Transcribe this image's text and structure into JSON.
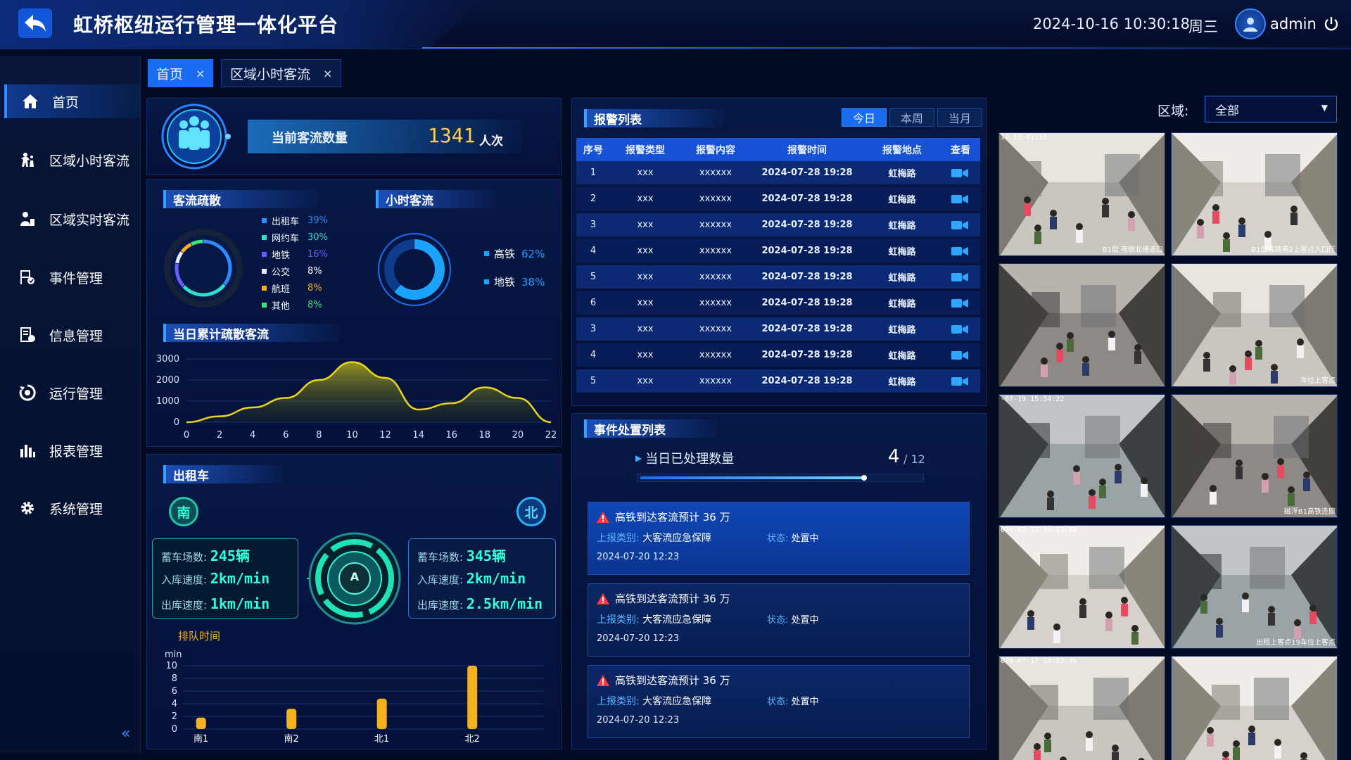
{
  "header": {
    "title": "虹桥枢纽运行管理一体化平台",
    "datetime": "2024-10-16 10:30:18",
    "weekday": "周三",
    "username": "admin"
  },
  "sidebar": {
    "items": [
      {
        "label": "首页",
        "icon": "home-icon"
      },
      {
        "label": "区域小时客流",
        "icon": "crowd-icon"
      },
      {
        "label": "区域实时客流",
        "icon": "person-icon"
      },
      {
        "label": "事件管理",
        "icon": "event-icon"
      },
      {
        "label": "信息管理",
        "icon": "info-icon"
      },
      {
        "label": "运行管理",
        "icon": "operation-icon"
      },
      {
        "label": "报表管理",
        "icon": "chart-icon"
      },
      {
        "label": "系统管理",
        "icon": "gear-icon"
      }
    ],
    "collapse": "«"
  },
  "tabs": [
    {
      "label": "首页",
      "close": "×"
    },
    {
      "label": "区域小时客流",
      "close": "×"
    }
  ],
  "current": {
    "label": "当前客流数量",
    "value": "1341",
    "unit": "人次"
  },
  "dispersal": {
    "title": "客流疏散",
    "items": [
      {
        "name": "出租车",
        "pct": "39%",
        "value": 39,
        "color": "#2f8bff"
      },
      {
        "name": "网约车",
        "pct": "30%",
        "value": 30,
        "color": "#2fe0c8"
      },
      {
        "name": "地铁",
        "pct": "16%",
        "value": 16,
        "color": "#6a5cff"
      },
      {
        "name": "公交",
        "pct": "8%",
        "value": 8,
        "color": "#e6ecff"
      },
      {
        "name": "航班",
        "pct": "8%",
        "value": 8,
        "color": "#f5b21f"
      },
      {
        "name": "其他",
        "pct": "8%",
        "value": 8,
        "color": "#3ee37a"
      }
    ]
  },
  "hourly": {
    "title": "小时客流",
    "items": [
      {
        "name": "高铁",
        "pct": "62%",
        "value": 62,
        "color": "#1aa3ff"
      },
      {
        "name": "地铁",
        "pct": "38%",
        "value": 38,
        "color": "#0e3c8c"
      }
    ]
  },
  "cumulative": {
    "title": "当日累计疏散客流"
  },
  "chart_data": [
    {
      "type": "area",
      "title": "当日累计疏散客流",
      "x": [
        0,
        2,
        4,
        6,
        8,
        10,
        12,
        14,
        16,
        18,
        20,
        22
      ],
      "series": [
        {
          "values": [
            0,
            280,
            700,
            1150,
            2000,
            2850,
            2100,
            600,
            900,
            1650,
            1150,
            0
          ]
        }
      ],
      "xticks": [
        "0",
        "2",
        "4",
        "6",
        "8",
        "10",
        "12",
        "14",
        "16",
        "18",
        "20",
        "22"
      ],
      "yticks": [
        "0",
        "1000",
        "2000",
        "3000"
      ],
      "ylim": [
        0,
        3000
      ],
      "xlim": [
        0,
        22
      ],
      "grid": true
    },
    {
      "type": "bar",
      "title": "排队时间",
      "ylabel": "min",
      "categories": [
        "南1",
        "南2",
        "北1",
        "北2"
      ],
      "values": [
        1.8,
        3.2,
        4.8,
        10
      ],
      "ylim": [
        0,
        10
      ],
      "yticks": [
        "0",
        "2",
        "4",
        "6",
        "8",
        "10"
      ],
      "grid": true
    },
    {
      "type": "pie",
      "title": "客流疏散",
      "categories": [
        "出租车",
        "网约车",
        "地铁",
        "公交",
        "航班",
        "其他"
      ],
      "values": [
        39,
        30,
        16,
        8,
        8,
        8
      ]
    },
    {
      "type": "pie",
      "title": "小时客流",
      "categories": [
        "高铁",
        "地铁"
      ],
      "values": [
        62,
        38
      ]
    }
  ],
  "taxi": {
    "title": "出租车",
    "south_badge": "南",
    "north_badge": "北",
    "center_badge": "A",
    "south": {
      "l1": "蓄车场数:",
      "v1": "245辆",
      "l2": "入库速度:",
      "v2": "2km/min",
      "l3": "出库速度:",
      "v3": "1km/min"
    },
    "north": {
      "l1": "蓄车场数:",
      "v1": "345辆",
      "l2": "入库速度:",
      "v2": "2km/min",
      "l3": "出库速度:",
      "v3": "2.5km/min"
    },
    "queue_title": "排队时间"
  },
  "alarms": {
    "title": "报警列表",
    "filters": [
      "今日",
      "本周",
      "当月"
    ],
    "headers": [
      "序号",
      "报警类型",
      "报警内容",
      "报警时间",
      "报警地点",
      "查看"
    ],
    "rows": [
      [
        "1",
        "xxx",
        "xxxxxx",
        "2024-07-28 19:28",
        "虹梅路"
      ],
      [
        "2",
        "xxx",
        "xxxxxx",
        "2024-07-28 19:28",
        "虹梅路"
      ],
      [
        "3",
        "xxx",
        "xxxxxx",
        "2024-07-28 19:28",
        "虹梅路"
      ],
      [
        "4",
        "xxx",
        "xxxxxx",
        "2024-07-28 19:28",
        "虹梅路"
      ],
      [
        "5",
        "xxx",
        "xxxxxx",
        "2024-07-28 19:28",
        "虹梅路"
      ],
      [
        "6",
        "xxx",
        "xxxxxx",
        "2024-07-28 19:28",
        "虹梅路"
      ],
      [
        "3",
        "xxx",
        "xxxxxx",
        "2024-07-28 19:28",
        "虹梅路"
      ],
      [
        "4",
        "xxx",
        "xxxxxx",
        "2024-07-28 19:28",
        "虹梅路"
      ],
      [
        "5",
        "xxx",
        "xxxxxx",
        "2024-07-28 19:28",
        "虹梅路"
      ]
    ]
  },
  "events": {
    "title": "事件处置列表",
    "processed_label": "当日已处理数量",
    "processed": "4",
    "total": "/ 12",
    "progress": 0.8,
    "cards": [
      {
        "title": "高铁到达客流预计 36 万",
        "cat_label": "上报类别:",
        "cat": "大客流应急保障",
        "status_label": "状态:",
        "status": "处置中",
        "time": "2024-07-20  12:23"
      },
      {
        "title": "高铁到达客流预计 36 万",
        "cat_label": "上报类别:",
        "cat": "大客流应急保障",
        "status_label": "状态:",
        "status": "处置中",
        "time": "2024-07-20  12:23"
      },
      {
        "title": "高铁到达客流预计 36 万",
        "cat_label": "上报类别:",
        "cat": "大客流应急保障",
        "status_label": "状态:",
        "status": "处置中",
        "time": "2024-07-20  12:23"
      }
    ]
  },
  "region": {
    "label": "区域:",
    "selected": "全部"
  },
  "cameras": [
    {
      "ts": "17 15:01:15",
      "label": "B1层 南侧北通道口"
    },
    {
      "ts": "",
      "label": "B1层高铁南2上客点入口厅"
    },
    {
      "ts": "",
      "label": ""
    },
    {
      "ts": "",
      "label": "车位上客点"
    },
    {
      "ts": "-07-19 15:34:22",
      "label": ""
    },
    {
      "ts": "",
      "label": "磁浮B1高铁连廊"
    },
    {
      "ts": "024-07-17 14:53:46",
      "label": ""
    },
    {
      "ts": "",
      "label": "出租上客点19车位上客点"
    },
    {
      "ts": "024-07-17 14:53:46",
      "label": ""
    },
    {
      "ts": "",
      "label": ""
    }
  ]
}
